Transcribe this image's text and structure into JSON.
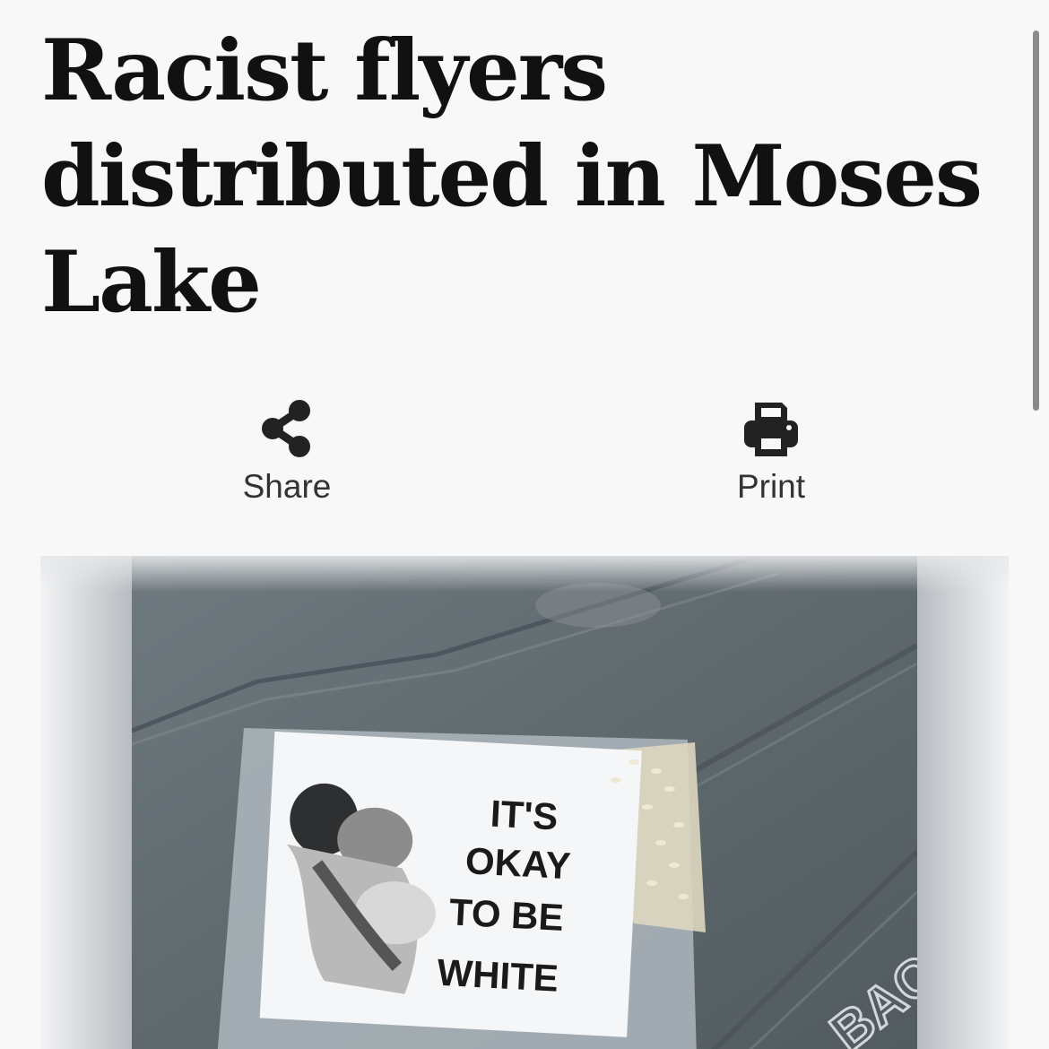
{
  "article": {
    "headline": "Racist flyers distributed in Moses Lake"
  },
  "actions": {
    "share_label": "Share",
    "print_label": "Print"
  },
  "photo": {
    "flyer_text_line1": "IT'S",
    "flyer_text_line2": "OKAY",
    "flyer_text_line3": "TO BE",
    "flyer_text_line4": "WHITE",
    "bin_lettering": "BAC"
  },
  "colors": {
    "background": "#f8f8f8",
    "headline": "#111111",
    "action_icon": "#222222",
    "action_label": "#333333",
    "bin_lid": "#5f6a70"
  },
  "icons": {
    "share": "share-icon",
    "print": "printer-icon"
  }
}
